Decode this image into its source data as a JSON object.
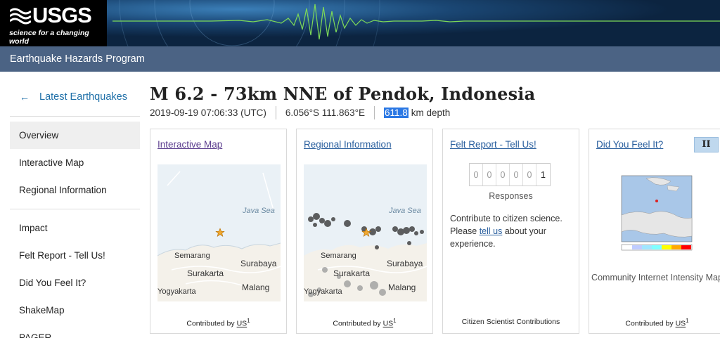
{
  "header": {
    "logo_text": "USGS",
    "logo_tagline": "science for a changing world",
    "program_title": "Earthquake Hazards Program"
  },
  "sidebar": {
    "back_label": "Latest Earthquakes",
    "items": [
      {
        "label": "Overview",
        "active": true
      },
      {
        "label": "Interactive Map"
      },
      {
        "label": "Regional Information"
      },
      {
        "label": "Impact"
      },
      {
        "label": "Felt Report - Tell Us!"
      },
      {
        "label": "Did You Feel It?"
      },
      {
        "label": "ShakeMap"
      },
      {
        "label": "PAGER"
      }
    ]
  },
  "event": {
    "title": "M 6.2 - 73km NNE of Pendok, Indonesia",
    "time": "2019-09-19 07:06:33 (UTC)",
    "location": "6.056°S 111.863°E",
    "depth_value": "611.8",
    "depth_unit": "km depth"
  },
  "cards": {
    "interactive_map": {
      "link": "Interactive Map",
      "footer_prefix": "Contributed by",
      "footer_link": "US",
      "footer_sup": "1",
      "map_labels": [
        "Java Sea",
        "Semarang",
        "Surakarta",
        "Surabaya",
        "Yogyakarta",
        "Malang"
      ]
    },
    "regional_info": {
      "link": "Regional Information",
      "footer_prefix": "Contributed by",
      "footer_link": "US",
      "footer_sup": "1",
      "map_labels": [
        "Java Sea",
        "Semarang",
        "Surakarta",
        "Surabaya",
        "Yogyakarta",
        "Malang"
      ]
    },
    "felt_report": {
      "link": "Felt Report - Tell Us!",
      "digits": [
        "0",
        "0",
        "0",
        "0",
        "0",
        "1"
      ],
      "responses_label": "Responses",
      "text_before": "Contribute to citizen science. Please ",
      "text_link": "tell us",
      "text_after": " about your experience.",
      "footer": "Citizen Scientist Contributions"
    },
    "dyfi": {
      "link": "Did You Feel It?",
      "mmi": "II",
      "caption": "Community Internet Intensity Map",
      "footer_prefix": "Contributed by",
      "footer_link": "US",
      "footer_sup": "1"
    }
  },
  "colors": {
    "header_bg": "#0c2440",
    "program_bar": "#4b6384",
    "link": "#2a5f9e",
    "highlight": "#2b78e4",
    "mmi_badge": "#bfd8ee",
    "epicenter_star": "#f0a830"
  }
}
